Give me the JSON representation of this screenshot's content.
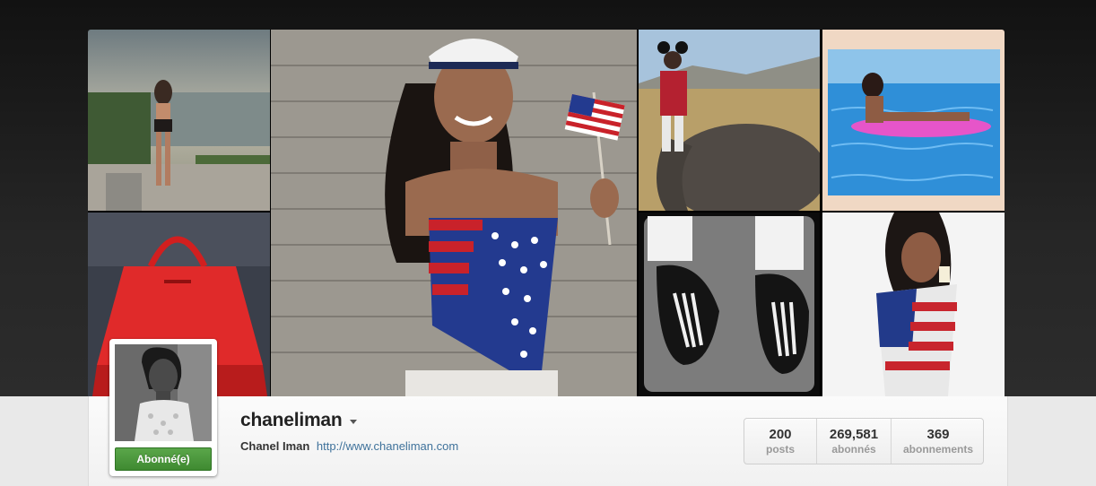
{
  "profile": {
    "username": "chaneliman",
    "full_name": "Chanel Iman",
    "website": "http://www.chaneliman.com",
    "follow_button_label": "Abonné(e)",
    "avatar_icon": "profile-photo"
  },
  "stats": [
    {
      "value": "200",
      "label": "posts"
    },
    {
      "value": "269,581",
      "label": "abonnés"
    },
    {
      "value": "369",
      "label": "abonnements"
    }
  ],
  "photos": [
    {
      "name": "photo-balcony"
    },
    {
      "name": "photo-flag-portrait"
    },
    {
      "name": "photo-elephant"
    },
    {
      "name": "photo-pool"
    },
    {
      "name": "photo-red-bag"
    },
    {
      "name": "photo-skeleton-shoes"
    },
    {
      "name": "photo-flag-sweater"
    }
  ],
  "colors": {
    "follow_green": "#4a9a3c",
    "link_blue": "#3f729b",
    "header_dark": "#1e1e1e"
  }
}
